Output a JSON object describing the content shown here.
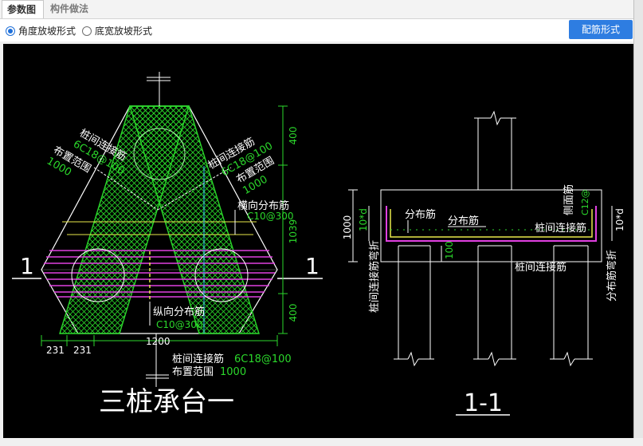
{
  "tabs": {
    "param_tab": "参数图",
    "component_tab": "构件做法"
  },
  "options": {
    "angle_label": "角度放坡形式",
    "width_label": "底宽放坡形式",
    "selected": "angle"
  },
  "toolbar": {
    "rebar_button": "配筋形式"
  },
  "drawing": {
    "plan": {
      "title": "三桩承台一",
      "section_mark": "1",
      "left_label_1": "桩间连接筋",
      "left_label_2": "6C18@100",
      "left_label_3": "布置范围",
      "left_label_4": "1000",
      "right_label_1": "桩间连接筋",
      "right_label_2": "6C18@100",
      "right_label_3": "布置范围",
      "right_label_4": "1000",
      "transverse_label": "横向分布筋",
      "transverse_value": "C10@300",
      "longitudinal_label": "纵向分布筋",
      "longitudinal_value": "C10@300",
      "bottom_label_1": "桩间连接筋",
      "bottom_value_1": "6C18@100",
      "bottom_label_2": "布置范围",
      "bottom_value_2": "1000",
      "dim_400_top": "400",
      "dim_1039": "1039",
      "dim_400_bottom": "400",
      "dim_231_a": "231",
      "dim_231_b": "231",
      "dim_1200": "1200"
    },
    "section": {
      "title": "1-1",
      "dist_rebar_1": "分布筋",
      "dist_rebar_2": "分布筋",
      "pile_link_1": "桩间连接筋",
      "pile_link_2": "桩间连接筋",
      "side_rebar": "侧面筋",
      "side_rebar_value": "C12@",
      "left_bend": "桩间连接筋弯折",
      "right_bend": "分布筋弯折",
      "dim_1000": "1000",
      "dim_10d_left": "10*d",
      "dim_10d_right": "10*d",
      "dim_100": "100"
    }
  }
}
